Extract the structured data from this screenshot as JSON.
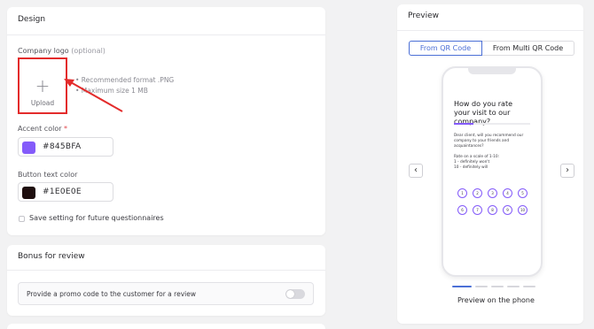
{
  "design": {
    "title": "Design",
    "logo_label": "Company logo",
    "logo_optional": "(optional)",
    "upload_label": "Upload",
    "hint_format": "• Recommended format .PNG",
    "hint_size": "• Maximum size 1 MB",
    "accent_label": "Accent color",
    "accent_required_mark": "*",
    "accent_value": "#845BFA",
    "button_text_label": "Button text color",
    "button_text_value": "#1E0E0E",
    "save_setting_label": "Save setting for future questionnaires"
  },
  "bonus": {
    "title": "Bonus for review",
    "promo_label": "Provide a promo code to the customer for a review"
  },
  "preview": {
    "title": "Preview",
    "tab_qr": "From QR Code",
    "tab_multi": "From Multi QR Code",
    "prev_icon": "‹",
    "next_icon": "›",
    "question": "How do you rate your visit to our company?",
    "progress": 0.25,
    "body_lines": [
      "Dear client, will you recommend our",
      "company to your friends and",
      "acquaintances?"
    ],
    "scale_lines": [
      "Rate on a scale of 1-10:",
      "1 - definitely won't",
      "10 - definitely will"
    ],
    "rating": [
      "1",
      "2",
      "3",
      "4",
      "5",
      "6",
      "7",
      "8",
      "9",
      "10"
    ],
    "caption": "Preview on the phone"
  },
  "colors": {
    "accent": "#845BFA",
    "button_text": "#1E0E0E",
    "highlight": "#E32B2B",
    "active_tab": "#4B6FD6"
  }
}
